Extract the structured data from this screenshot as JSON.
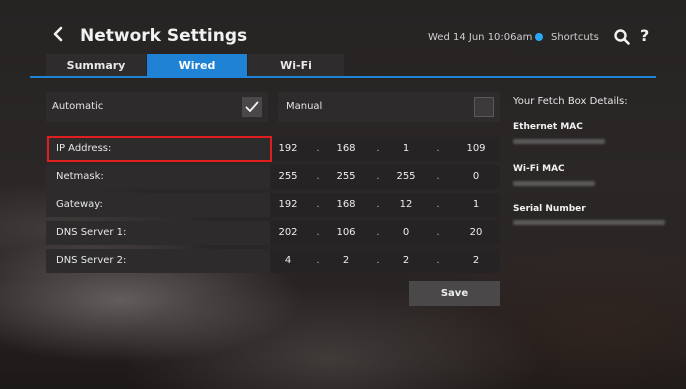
{
  "header": {
    "title": "Network Settings",
    "datetime": "Wed 14 Jun 10:06am",
    "shortcuts_label": "Shortcuts",
    "help_label": "?"
  },
  "tabs": [
    {
      "label": "Summary",
      "active": false
    },
    {
      "label": "Wired",
      "active": true
    },
    {
      "label": "Wi-Fi",
      "active": false
    }
  ],
  "mode": {
    "automatic_label": "Automatic",
    "automatic_checked": true,
    "manual_label": "Manual",
    "manual_checked": false
  },
  "fields": [
    {
      "label": "IP Address:",
      "octets": [
        "192",
        "168",
        "1",
        "109"
      ],
      "selected": true
    },
    {
      "label": "Netmask:",
      "octets": [
        "255",
        "255",
        "255",
        "0"
      ],
      "selected": false
    },
    {
      "label": "Gateway:",
      "octets": [
        "192",
        "168",
        "12",
        "1"
      ],
      "selected": false
    },
    {
      "label": "DNS Server 1:",
      "octets": [
        "202",
        "106",
        "0",
        "20"
      ],
      "selected": false
    },
    {
      "label": "DNS Server 2:",
      "octets": [
        "4",
        "2",
        "2",
        "2"
      ],
      "selected": false
    }
  ],
  "octet_separator": ".",
  "save_label": "Save",
  "details": {
    "title": "Your Fetch Box Details:",
    "ethernet_mac_label": "Ethernet MAC",
    "wifi_mac_label": "Wi-Fi MAC",
    "serial_number_label": "Serial Number"
  },
  "colors": {
    "accent": "#1f82d4",
    "status_dot": "#29a8f5",
    "highlight": "#e01e1e"
  }
}
